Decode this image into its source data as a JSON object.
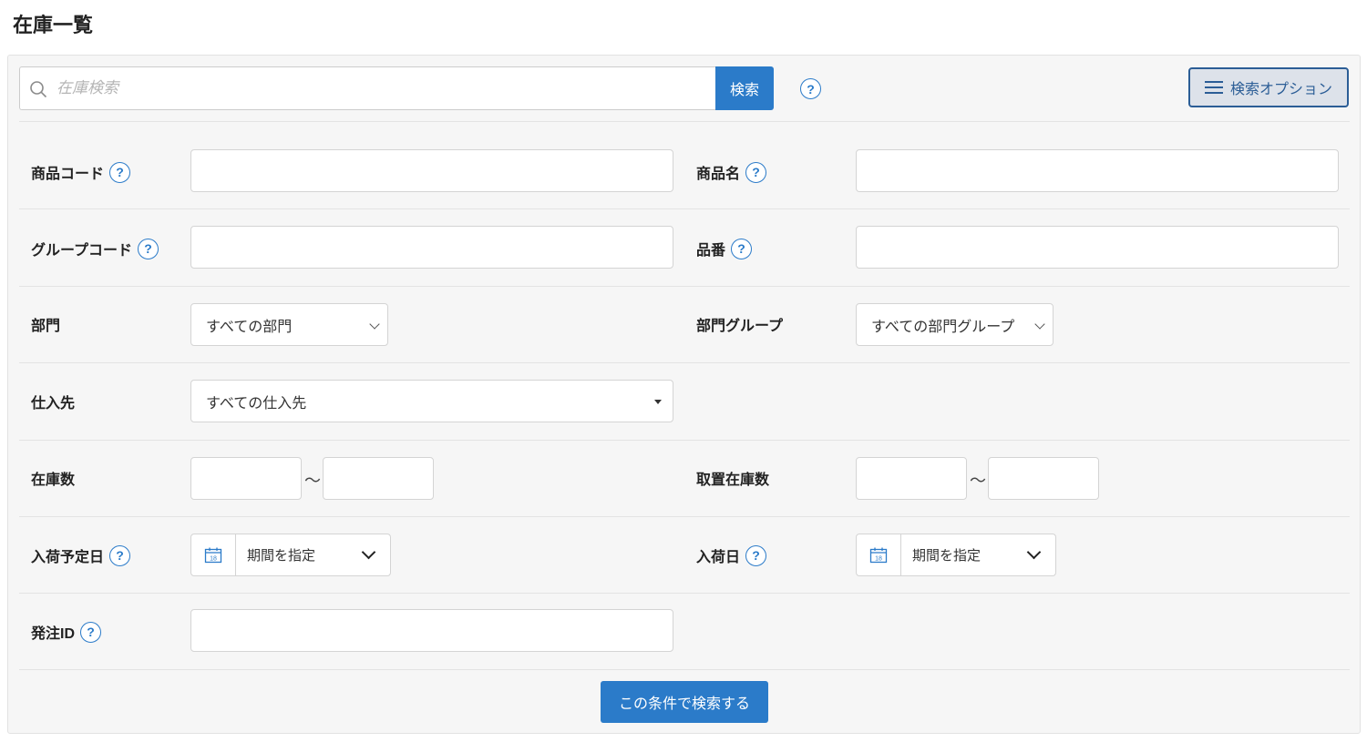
{
  "page": {
    "title": "在庫一覧"
  },
  "search": {
    "placeholder": "在庫検索",
    "button_label": "検索",
    "help": "?"
  },
  "options_button": {
    "label": "検索オプション"
  },
  "fields": {
    "product_code": {
      "label": "商品コード",
      "help": "?"
    },
    "product_name": {
      "label": "商品名",
      "help": "?"
    },
    "group_code": {
      "label": "グループコード",
      "help": "?"
    },
    "item_number": {
      "label": "品番",
      "help": "?"
    },
    "department": {
      "label": "部門",
      "selected": "すべての部門"
    },
    "department_group": {
      "label": "部門グループ",
      "selected": "すべての部門グループ"
    },
    "supplier": {
      "label": "仕入先",
      "selected": "すべての仕入先"
    },
    "stock_qty": {
      "label": "在庫数",
      "separator": "〜"
    },
    "reserved_qty": {
      "label": "取置在庫数",
      "separator": "〜"
    },
    "expected_arrival": {
      "label": "入荷予定日",
      "help": "?",
      "picker_label": "期間を指定",
      "calendar_day": "18"
    },
    "arrival_date": {
      "label": "入荷日",
      "help": "?",
      "picker_label": "期間を指定",
      "calendar_day": "18"
    },
    "order_id": {
      "label": "発注ID",
      "help": "?"
    }
  },
  "submit": {
    "label": "この条件で検索する"
  },
  "colors": {
    "primary": "#2b7bc9",
    "options_border": "#2b5d96",
    "panel_bg": "#f6f6f6"
  }
}
